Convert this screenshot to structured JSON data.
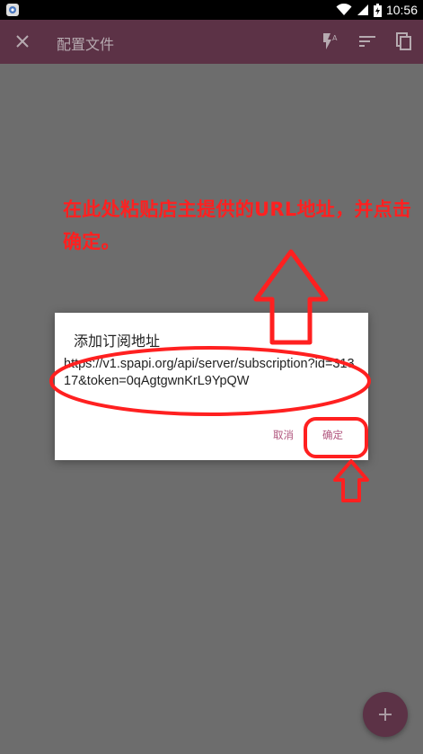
{
  "status_bar": {
    "time": "10:56",
    "icons": [
      "app-notification-icon",
      "wifi-icon",
      "signal-icon",
      "battery-icon"
    ]
  },
  "app_bar": {
    "title": "配置文件",
    "actions": [
      "close-icon",
      "flash-auto-icon",
      "sort-icon",
      "copy-icon"
    ],
    "color": "#5c3246"
  },
  "dialog": {
    "title": "添加订阅地址",
    "url_value": "https://v1.spapi.org/api/server/subscription?id=31317&token=0qAgtgwnKrL9YpQW",
    "cancel_label": "取消",
    "confirm_label": "确定",
    "button_color": "#b0557d"
  },
  "annotation": {
    "instruction": "在此处粘贴店主提供的URL地址，并点击确定。",
    "color": "#ff2020"
  },
  "fab": {
    "icon": "plus-icon"
  }
}
